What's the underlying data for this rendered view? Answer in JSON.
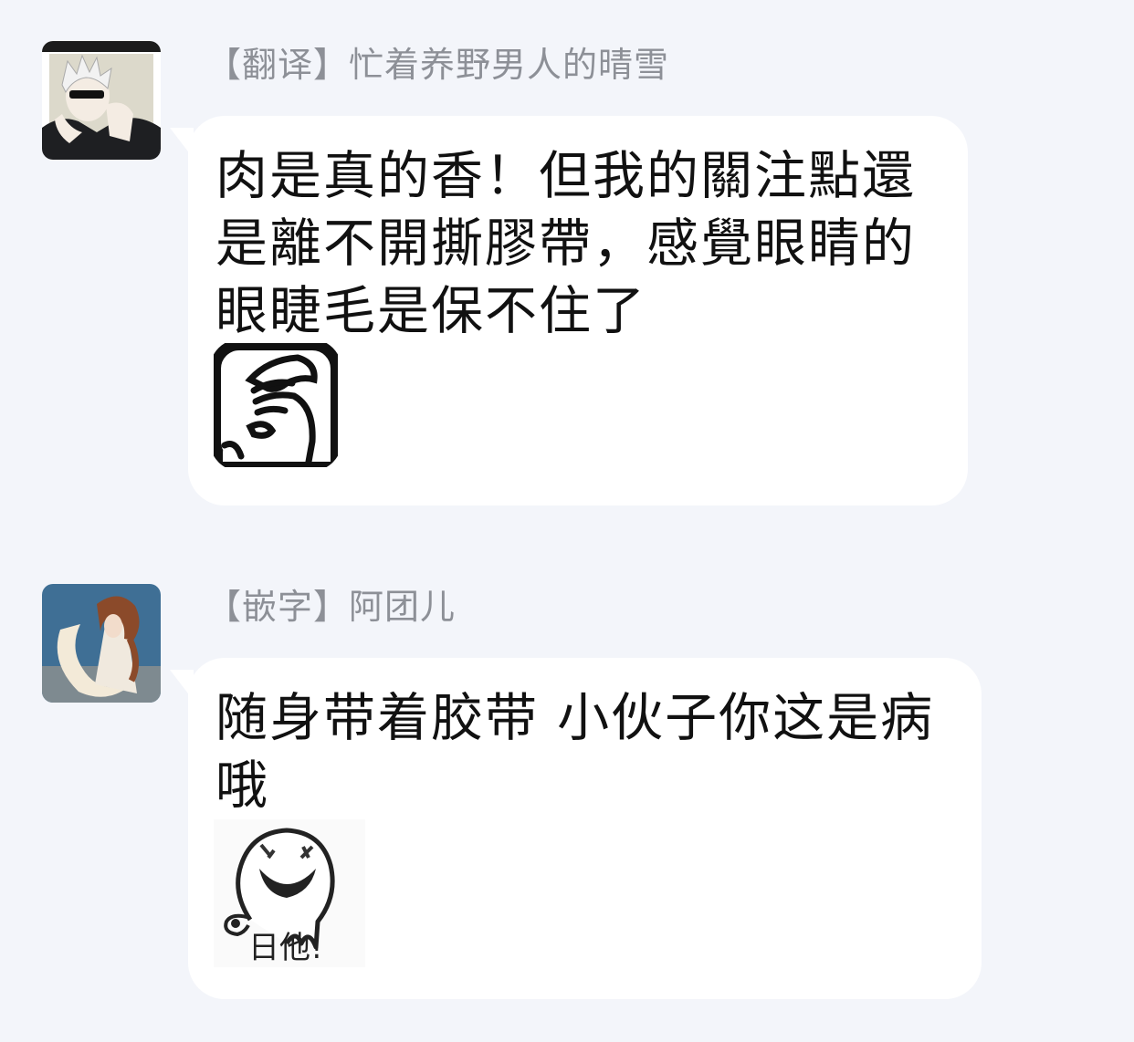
{
  "messages": [
    {
      "author": "【翻译】忙着养野男人的晴雪",
      "avatar_icon": "user-avatar-white-hair-icon",
      "text_lines": [
        "肉是真的香！但我的關注點還",
        "是離不開撕膠帶，感覺眼睛的",
        "眼睫毛是保不住了"
      ],
      "sticker_icon": "facepalm-sticker-icon"
    },
    {
      "author": "【嵌字】阿团儿",
      "avatar_icon": "user-avatar-moon-girl-icon",
      "text_lines": [
        "随身带着胶带 小伙子你这是病",
        "哦"
      ],
      "sticker_icon": "laughing-ghost-sticker-icon",
      "sticker_caption": "日他!"
    }
  ],
  "colors": {
    "background": "#f3f5fa",
    "bubble": "#ffffff",
    "nickname": "#8d9097",
    "text": "#111111"
  }
}
